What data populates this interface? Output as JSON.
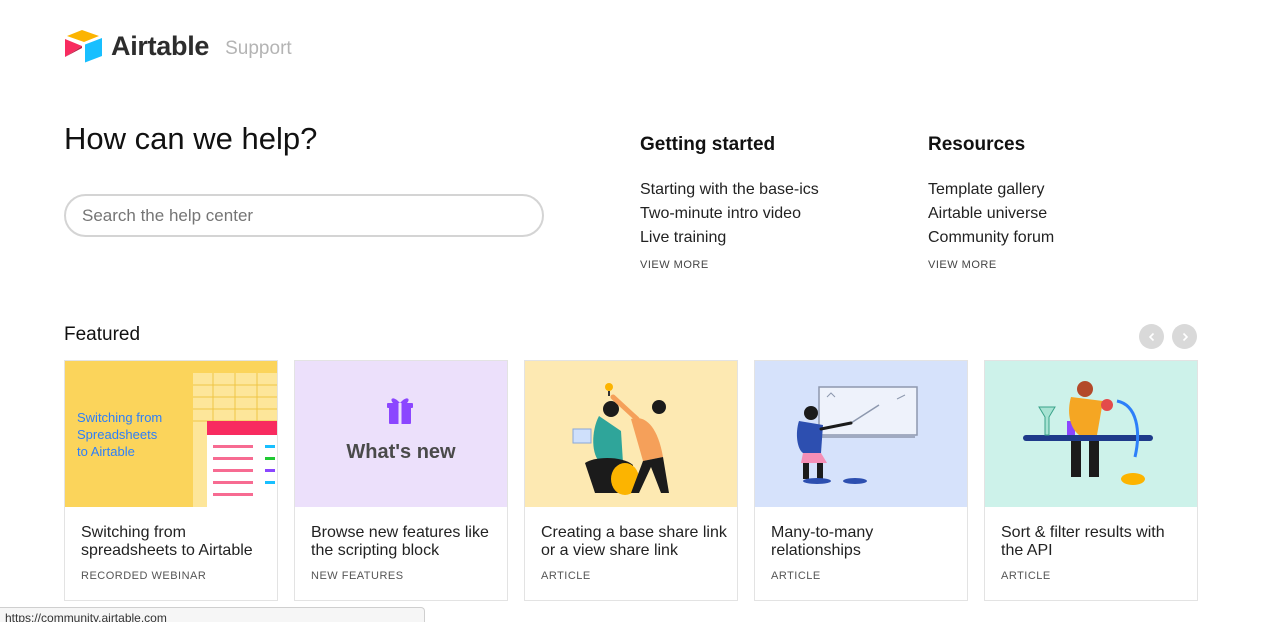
{
  "header": {
    "logo_text": "Airtable",
    "subtitle": "Support"
  },
  "hero": {
    "title": "How can we help?",
    "search_placeholder": "Search the help center"
  },
  "getting_started": {
    "heading": "Getting started",
    "links": [
      "Starting with the base-ics",
      "Two-minute intro video",
      "Live training"
    ],
    "view_more": "VIEW MORE"
  },
  "resources": {
    "heading": "Resources",
    "links": [
      "Template gallery",
      "Airtable universe",
      "Community forum"
    ],
    "view_more": "VIEW MORE"
  },
  "featured": {
    "heading": "Featured",
    "cards": [
      {
        "thumb_text": [
          "Switching from",
          "Spreadsheets",
          "to Airtable"
        ],
        "title": "Switching from spreadsheets to Airtable",
        "kind": "RECORDED WEBINAR",
        "bg": "#fbd45b"
      },
      {
        "thumb_text": [
          "What's new"
        ],
        "title": "Browse new features like the scripting block",
        "kind": "NEW FEATURES",
        "bg": "#ece0fb"
      },
      {
        "title": "Creating a base share link or a view share link",
        "kind": "ARTICLE",
        "bg": "#fde9b2"
      },
      {
        "title": "Many-to-many relationships",
        "kind": "ARTICLE",
        "bg": "#d6e2fb"
      },
      {
        "title": "Sort & filter results with the API",
        "kind": "ARTICLE",
        "bg": "#cdf2ea"
      }
    ]
  },
  "status_bar": {
    "url": "https://community.airtable.com"
  },
  "colors": {
    "logo_yellow": "#fcb400",
    "logo_red": "#f82b60",
    "logo_blue": "#18bfff"
  }
}
